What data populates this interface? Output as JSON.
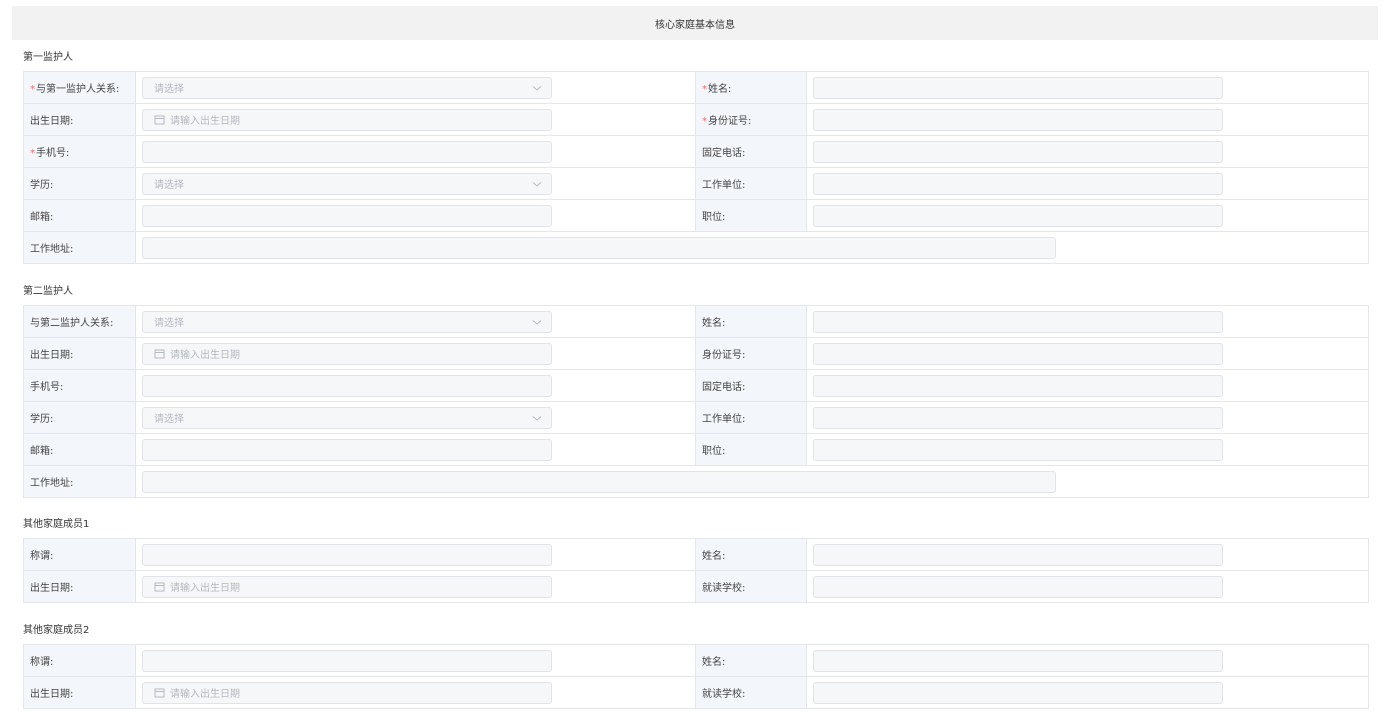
{
  "header": {
    "title": "核心家庭基本信息"
  },
  "placeholders": {
    "select": "请选择",
    "date": "请输入出生日期"
  },
  "colors": {
    "required": "#f56c6c",
    "label_bg": "#f3f6fa",
    "border": "#e3e6eb",
    "header_bg": "#f2f2f2"
  },
  "icons": {
    "select": "chevron-down-icon",
    "date": "calendar-icon"
  },
  "guardian1": {
    "title": "第一监护人",
    "relation": "与第一监护人关系:",
    "name": "姓名:",
    "birth": "出生日期:",
    "idcard": "身份证号:",
    "phone": "手机号:",
    "landline": "固定电话:",
    "education": "学历:",
    "workplace": "工作单位:",
    "email": "邮箱:",
    "position": "职位:",
    "work_address": "工作地址:"
  },
  "guardian2": {
    "title": "第二监护人",
    "relation": "与第二监护人关系:",
    "name": "姓名:",
    "birth": "出生日期:",
    "idcard": "身份证号:",
    "phone": "手机号:",
    "landline": "固定电话:",
    "education": "学历:",
    "workplace": "工作单位:",
    "email": "邮箱:",
    "position": "职位:",
    "work_address": "工作地址:"
  },
  "member1": {
    "title": "其他家庭成员1",
    "appellation": "称谓:",
    "name": "姓名:",
    "birth": "出生日期:",
    "school": "就读学校:"
  },
  "member2": {
    "title": "其他家庭成员2",
    "appellation": "称谓:",
    "name": "姓名:",
    "birth": "出生日期:",
    "school": "就读学校:"
  }
}
